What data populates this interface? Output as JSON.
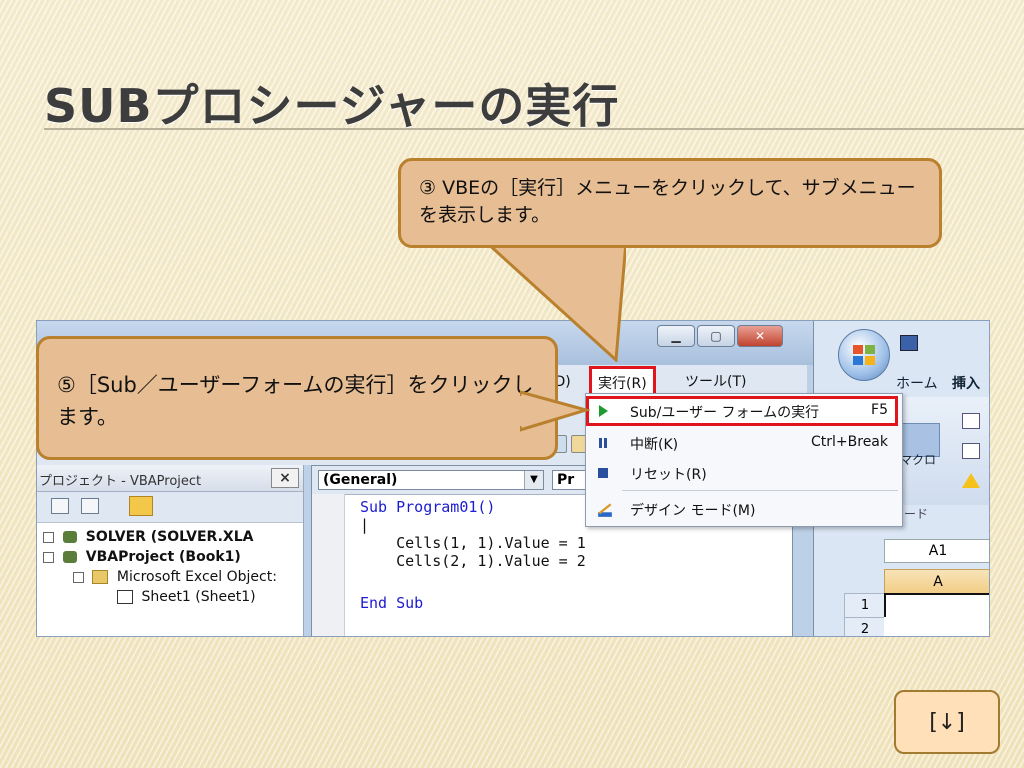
{
  "slide": {
    "title": "SUBプロシージャーの実行",
    "nav_button_label": "[↓]"
  },
  "callouts": {
    "step3": "③ VBEの［実行］メニューをクリックして、サブメニューを表示します。",
    "step5": "⑤［Sub／ユーザーフォームの実行］をクリックします。"
  },
  "vbe": {
    "menu": {
      "debug": "グ(D)",
      "run": "実行(R)",
      "tools": "ツール(T)"
    },
    "project": {
      "title": "プロジェクト - VBAProject",
      "close": "×",
      "tree": [
        {
          "label": "SOLVER (SOLVER.XLA",
          "bold": true
        },
        {
          "label": "VBAProject (Book1)",
          "bold": true
        },
        {
          "label": "Microsoft Excel Object:",
          "bold": false
        },
        {
          "label": "Sheet1 (Sheet1)",
          "bold": false
        }
      ]
    },
    "code": {
      "object_combo": "(General)",
      "proc_combo": "Pr",
      "lines": [
        "Sub Program01()",
        "|",
        "    Cells(1, 1).Value = 1",
        "    Cells(2, 1).Value = 2",
        "",
        "End Sub"
      ]
    },
    "run_menu": [
      {
        "icon": "run-icon",
        "label": "Sub/ユーザー フォームの実行",
        "key": "F5"
      },
      {
        "icon": "pause-icon",
        "label": "中断(K)",
        "key": "Ctrl+Break"
      },
      {
        "icon": "reset-icon",
        "label": "リセット(R)",
        "key": ""
      },
      {
        "icon": "design-mode-icon",
        "label": "デザイン モード(M)",
        "key": ""
      }
    ]
  },
  "excel": {
    "tabs": {
      "home": "ホーム",
      "insert": "挿入"
    },
    "macro_label": "マクロ",
    "group_label": "ード",
    "name_box": "A1",
    "column_header": "A",
    "row_headers": [
      "1",
      "2"
    ]
  },
  "colors": {
    "callout_fill": "#e7bd93",
    "callout_border": "#b9812d",
    "highlight_red": "#e0141b"
  }
}
